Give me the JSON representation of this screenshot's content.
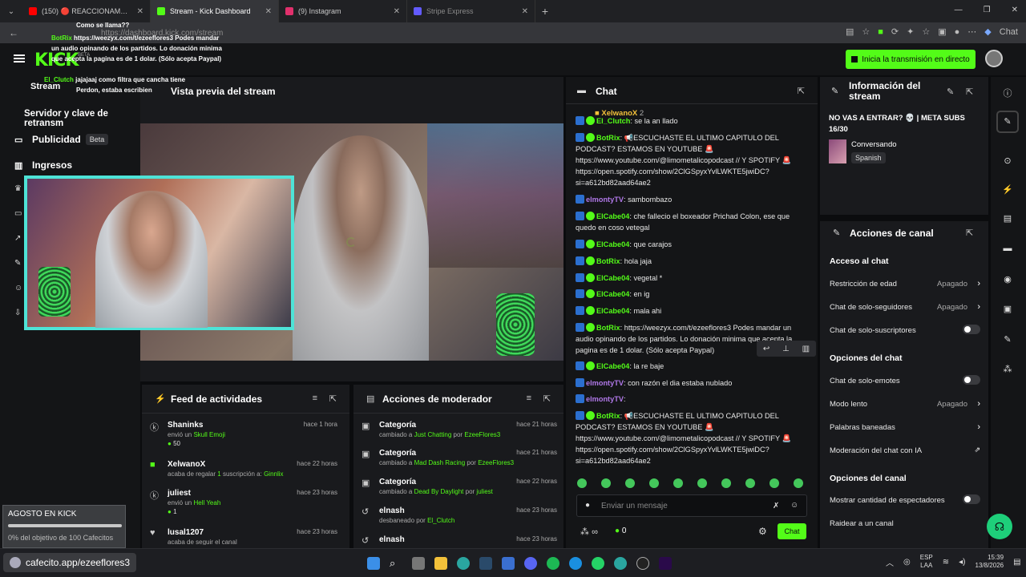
{
  "browser": {
    "tabs": [
      {
        "label": "(150) 🔴 REACCIONAMOS A LOS",
        "active": false,
        "favicon_color": "#ff0000"
      },
      {
        "label": "Stream - Kick Dashboard",
        "active": true,
        "favicon_color": "#53fc18"
      },
      {
        "label": "(9) Instagram",
        "active": false,
        "favicon_color": "#e1306c"
      },
      {
        "label": "Stripe Express",
        "active": false,
        "favicon_color": "#635bff"
      }
    ],
    "url": "https://dashboard.kick.com/stream",
    "profile_label": "Chat"
  },
  "header": {
    "logo": "KICK",
    "logo_beta": "BETA",
    "start_stream_label": "Inicia la transmisión en directo"
  },
  "sidebar": {
    "items": [
      {
        "label": "Stream",
        "icon": "stream-icon"
      },
      {
        "label": "Servidor y clave de retransm",
        "icon": "none"
      },
      {
        "label": "Publicidad",
        "badge": "Beta",
        "icon": "megaphone-icon"
      },
      {
        "label": "Ingresos",
        "icon": "chart-icon"
      }
    ]
  },
  "overlay_chat": [
    {
      "user": "",
      "text": "Como se llama??"
    },
    {
      "user": "BotRix",
      "text": "https://weezyx.com/t/ezeeflores3 Podes mandar un audio opinando de los partidos. Lo donación minima que acepta la pagina es de 1 dolar. (Sólo acepta Paypal)"
    },
    {
      "user": "El_Clutch",
      "text": "jajajaaj como filtra que cancha tiene"
    },
    {
      "user": "",
      "text": "Perdon, estaba escribien"
    }
  ],
  "preview": {
    "title": "Vista previa del stream"
  },
  "activity_feed": {
    "title": "Feed de actividades",
    "rows": [
      {
        "name": "Shaninks",
        "time": "hace 1 hora",
        "sub_pre": "envió un ",
        "sub_em": "Skull Emoji",
        "sub_post": "",
        "amount": "50"
      },
      {
        "name": "XelwanoX",
        "time": "hace 22 horas",
        "sub_pre": "acaba de regalar ",
        "sub_em": "1",
        "sub_post": " suscripción a: ",
        "sub_em2": "Ginnlix",
        "amount": ""
      },
      {
        "name": "juliest",
        "time": "hace 23 horas",
        "sub_pre": "envió un ",
        "sub_em": "Hell Yeah",
        "sub_post": "",
        "amount": "1"
      },
      {
        "name": "lusal1207",
        "time": "hace 23 horas",
        "sub_pre": "acaba de seguir el canal",
        "sub_em": "",
        "sub_post": "",
        "amount": ""
      }
    ]
  },
  "mod_actions": {
    "title": "Acciones de moderador",
    "rows": [
      {
        "name": "Categoría",
        "time": "hace 21 horas",
        "sub_pre": "cambiado a ",
        "sub_em": "Just Chatting",
        "sub_post": " por ",
        "sub_em2": "EzeeFlores3"
      },
      {
        "name": "Categoría",
        "time": "hace 21 horas",
        "sub_pre": "cambiado a ",
        "sub_em": "Mad Dash Racing",
        "sub_post": " por ",
        "sub_em2": "EzeeFlores3"
      },
      {
        "name": "Categoría",
        "time": "hace 22 horas",
        "sub_pre": "cambiado a ",
        "sub_em": "Dead By Daylight",
        "sub_post": " por ",
        "sub_em2": "juliest"
      },
      {
        "name": "elnash",
        "time": "hace 23 horas",
        "sub_pre": "desbaneado por ",
        "sub_em": "El_Clutch",
        "sub_post": "",
        "sub_em2": ""
      },
      {
        "name": "elnash",
        "time": "hace 23 horas",
        "sub_pre": "",
        "sub_em": "",
        "sub_post": "",
        "sub_em2": ""
      }
    ]
  },
  "chat": {
    "title": "Chat",
    "pinned_user": "XelwanoX",
    "pinned_count": "2",
    "messages": [
      {
        "user": "El_Clutch",
        "color": "green",
        "text": ": se la an llado"
      },
      {
        "user": "BotRix",
        "color": "green",
        "text": ": 📢ESCUCHASTE EL ULTIMO CAPITULO DEL PODCAST? ESTAMOS EN YOUTUBE 🚨 https://www.youtube.com/@limometalicopodcast // Y SPOTIFY 🚨 https://open.spotify.com/show/2ClGSpyxYvlLWKTE5jwiDC?si=a612bd82aad64ae2"
      },
      {
        "user": "elmontyTV",
        "color": "purple",
        "text": ": sambombazo"
      },
      {
        "user": "ElCabe04",
        "color": "green",
        "text": ": che fallecio el boxeador Prichad Colon, ese que quedo en coso vetegal"
      },
      {
        "user": "ElCabe04",
        "color": "green",
        "text": ": que carajos"
      },
      {
        "user": "BotRix",
        "color": "green",
        "text": ": hola jaja"
      },
      {
        "user": "ElCabe04",
        "color": "green",
        "text": ": vegetal *"
      },
      {
        "user": "ElCabe04",
        "color": "green",
        "text": ": en ig"
      },
      {
        "user": "ElCabe04",
        "color": "green",
        "text": ": mala ahi"
      },
      {
        "user": "BotRix",
        "color": "green",
        "text": ": https://weezyx.com/t/ezeeflores3 Podes mandar un audio opinando de los partidos. Lo donación minima que acepta la pagina es de 1 dolar. (Sólo acepta Paypal)"
      },
      {
        "user": "ElCabe04",
        "color": "green",
        "text": ": la re baje"
      },
      {
        "user": "elmontyTV",
        "color": "purple",
        "text": ": con razón el dia estaba nublado"
      },
      {
        "user": "elmontyTV",
        "color": "purple",
        "text": ":"
      },
      {
        "user": "BotRix",
        "color": "green",
        "text": ": 📢ESCUCHASTE EL ULTIMO CAPITULO DEL PODCAST? ESTAMOS EN YOUTUBE 🚨 https://www.youtube.com/@limometalicopodcast // Y SPOTIFY 🚨 https://open.spotify.com/show/2ClGSpyxYvlLWKTE5jwiDC?si=a612bd82aad64ae2"
      }
    ],
    "input_placeholder": "Enviar un mensaje",
    "viewers_label": "∞",
    "points": "0",
    "send_label": "Chat"
  },
  "stream_info": {
    "title": "Información del stream",
    "stream_title": "NO VAS A ENTRAR? 💀 | META SUBS 16/30",
    "category": "Conversando",
    "language": "Spanish"
  },
  "channel_actions": {
    "title": "Acciones de canal",
    "sections": [
      {
        "title": "Acceso al chat",
        "rows": [
          {
            "label": "Restricción de edad",
            "value": "Apagado",
            "type": "chevron"
          },
          {
            "label": "Chat de solo-seguidores",
            "value": "Apagado",
            "type": "chevron"
          },
          {
            "label": "Chat de solo-suscriptores",
            "value": "",
            "type": "toggle"
          }
        ]
      },
      {
        "title": "Opciones del chat",
        "rows": [
          {
            "label": "Chat de solo-emotes",
            "value": "",
            "type": "toggle"
          },
          {
            "label": "Modo lento",
            "value": "Apagado",
            "type": "chevron"
          },
          {
            "label": "Palabras baneadas",
            "value": "",
            "type": "chevron"
          },
          {
            "label": "Moderación del chat con IA",
            "value": "",
            "type": "external"
          }
        ]
      },
      {
        "title": "Opciones del canal",
        "rows": [
          {
            "label": "Mostrar cantidad de espectadores",
            "value": "",
            "type": "toggle"
          },
          {
            "label": "Raidear a un canal",
            "value": "",
            "type": "none"
          }
        ]
      }
    ]
  },
  "goal": {
    "title": "AGOSTO EN KICK",
    "text": "0% del objetivo de 100 Cafecitos",
    "progress": 0
  },
  "bottom_link": "cafecito.app/ezeeflores3",
  "taskbar": {
    "lang": "ESP",
    "lang2": "LAA",
    "time": "15:39",
    "date": "13/8/2026"
  }
}
